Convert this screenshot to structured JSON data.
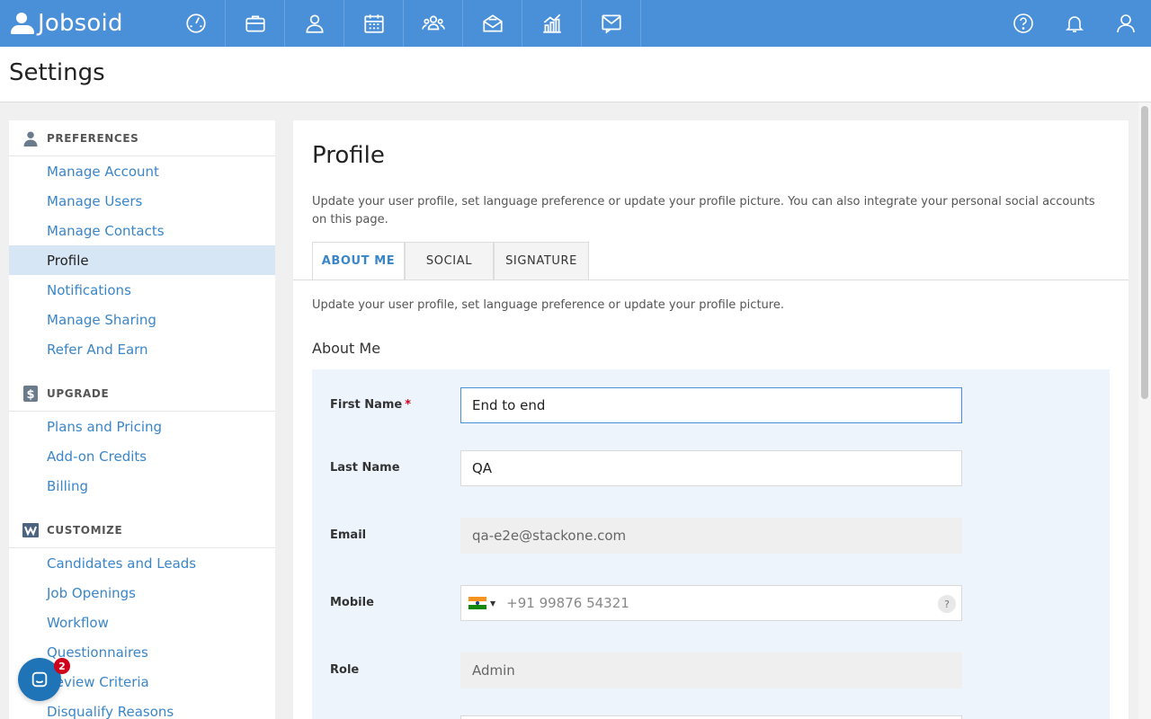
{
  "app": {
    "logo_text": "Jobsoid",
    "colors": {
      "topbar": "#4a90d9",
      "link": "#3a86c8",
      "active_bg": "#d6e6f5",
      "form_bg": "#edf4fc",
      "required": "#d0021b"
    }
  },
  "nav": {
    "icons": [
      "dashboard-icon",
      "jobs-briefcase-icon",
      "candidates-person-icon",
      "calendar-icon",
      "team-icon",
      "mail-campaign-icon",
      "reports-chart-icon",
      "inbox-icon"
    ],
    "right_icons": [
      "help-icon",
      "notifications-bell-icon",
      "user-account-icon"
    ]
  },
  "page": {
    "title": "Settings"
  },
  "sidebar": {
    "sections": [
      {
        "header": "PREFERENCES",
        "icon": "person-icon",
        "items": [
          "Manage Account",
          "Manage Users",
          "Manage Contacts",
          "Profile",
          "Notifications",
          "Manage Sharing",
          "Refer And Earn"
        ],
        "active": "Profile"
      },
      {
        "header": "UPGRADE",
        "icon": "dollar-icon",
        "items": [
          "Plans and Pricing",
          "Add-on Credits",
          "Billing"
        ]
      },
      {
        "header": "CUSTOMIZE",
        "icon": "customize-icon",
        "items": [
          "Candidates and Leads",
          "Job Openings",
          "Workflow",
          "Questionnaires",
          "Review Criteria",
          "Disqualify Reasons"
        ]
      }
    ]
  },
  "main": {
    "title": "Profile",
    "description": "Update your user profile, set language preference or update your profile picture. You can also integrate your personal social accounts on this page.",
    "tabs": [
      {
        "label": "ABOUT ME",
        "active": true
      },
      {
        "label": "SOCIAL",
        "active": false
      },
      {
        "label": "SIGNATURE",
        "active": false
      }
    ],
    "sub_description": "Update your user profile, set language preference or update your profile picture.",
    "section_title": "About Me",
    "form": {
      "first_name": {
        "label": "First Name",
        "required_mark": "*",
        "value": "End to end"
      },
      "last_name": {
        "label": "Last Name",
        "value": "QA"
      },
      "email": {
        "label": "Email",
        "value": "qa-e2e@stackone.com"
      },
      "mobile": {
        "label": "Mobile",
        "placeholder": "+91 99876 54321",
        "country": "India",
        "help": "?"
      },
      "role": {
        "label": "Role",
        "value": "Admin"
      }
    }
  },
  "chat": {
    "badge_count": "2"
  }
}
